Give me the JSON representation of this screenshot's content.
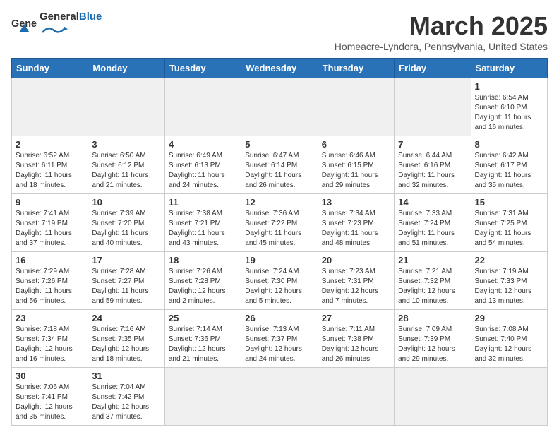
{
  "logo": {
    "general": "General",
    "blue": "Blue"
  },
  "header": {
    "month": "March 2025",
    "location": "Homeacre-Lyndora, Pennsylvania, United States"
  },
  "weekdays": [
    "Sunday",
    "Monday",
    "Tuesday",
    "Wednesday",
    "Thursday",
    "Friday",
    "Saturday"
  ],
  "weeks": [
    [
      {
        "day": "",
        "empty": true
      },
      {
        "day": "",
        "empty": true
      },
      {
        "day": "",
        "empty": true
      },
      {
        "day": "",
        "empty": true
      },
      {
        "day": "",
        "empty": true
      },
      {
        "day": "",
        "empty": true
      },
      {
        "day": "1",
        "info": "Sunrise: 6:54 AM\nSunset: 6:10 PM\nDaylight: 11 hours and 16 minutes."
      }
    ],
    [
      {
        "day": "2",
        "info": "Sunrise: 6:52 AM\nSunset: 6:11 PM\nDaylight: 11 hours and 18 minutes."
      },
      {
        "day": "3",
        "info": "Sunrise: 6:50 AM\nSunset: 6:12 PM\nDaylight: 11 hours and 21 minutes."
      },
      {
        "day": "4",
        "info": "Sunrise: 6:49 AM\nSunset: 6:13 PM\nDaylight: 11 hours and 24 minutes."
      },
      {
        "day": "5",
        "info": "Sunrise: 6:47 AM\nSunset: 6:14 PM\nDaylight: 11 hours and 26 minutes."
      },
      {
        "day": "6",
        "info": "Sunrise: 6:46 AM\nSunset: 6:15 PM\nDaylight: 11 hours and 29 minutes."
      },
      {
        "day": "7",
        "info": "Sunrise: 6:44 AM\nSunset: 6:16 PM\nDaylight: 11 hours and 32 minutes."
      },
      {
        "day": "8",
        "info": "Sunrise: 6:42 AM\nSunset: 6:17 PM\nDaylight: 11 hours and 35 minutes."
      }
    ],
    [
      {
        "day": "9",
        "info": "Sunrise: 7:41 AM\nSunset: 7:19 PM\nDaylight: 11 hours and 37 minutes."
      },
      {
        "day": "10",
        "info": "Sunrise: 7:39 AM\nSunset: 7:20 PM\nDaylight: 11 hours and 40 minutes."
      },
      {
        "day": "11",
        "info": "Sunrise: 7:38 AM\nSunset: 7:21 PM\nDaylight: 11 hours and 43 minutes."
      },
      {
        "day": "12",
        "info": "Sunrise: 7:36 AM\nSunset: 7:22 PM\nDaylight: 11 hours and 45 minutes."
      },
      {
        "day": "13",
        "info": "Sunrise: 7:34 AM\nSunset: 7:23 PM\nDaylight: 11 hours and 48 minutes."
      },
      {
        "day": "14",
        "info": "Sunrise: 7:33 AM\nSunset: 7:24 PM\nDaylight: 11 hours and 51 minutes."
      },
      {
        "day": "15",
        "info": "Sunrise: 7:31 AM\nSunset: 7:25 PM\nDaylight: 11 hours and 54 minutes."
      }
    ],
    [
      {
        "day": "16",
        "info": "Sunrise: 7:29 AM\nSunset: 7:26 PM\nDaylight: 11 hours and 56 minutes."
      },
      {
        "day": "17",
        "info": "Sunrise: 7:28 AM\nSunset: 7:27 PM\nDaylight: 11 hours and 59 minutes."
      },
      {
        "day": "18",
        "info": "Sunrise: 7:26 AM\nSunset: 7:28 PM\nDaylight: 12 hours and 2 minutes."
      },
      {
        "day": "19",
        "info": "Sunrise: 7:24 AM\nSunset: 7:30 PM\nDaylight: 12 hours and 5 minutes."
      },
      {
        "day": "20",
        "info": "Sunrise: 7:23 AM\nSunset: 7:31 PM\nDaylight: 12 hours and 7 minutes."
      },
      {
        "day": "21",
        "info": "Sunrise: 7:21 AM\nSunset: 7:32 PM\nDaylight: 12 hours and 10 minutes."
      },
      {
        "day": "22",
        "info": "Sunrise: 7:19 AM\nSunset: 7:33 PM\nDaylight: 12 hours and 13 minutes."
      }
    ],
    [
      {
        "day": "23",
        "info": "Sunrise: 7:18 AM\nSunset: 7:34 PM\nDaylight: 12 hours and 16 minutes."
      },
      {
        "day": "24",
        "info": "Sunrise: 7:16 AM\nSunset: 7:35 PM\nDaylight: 12 hours and 18 minutes."
      },
      {
        "day": "25",
        "info": "Sunrise: 7:14 AM\nSunset: 7:36 PM\nDaylight: 12 hours and 21 minutes."
      },
      {
        "day": "26",
        "info": "Sunrise: 7:13 AM\nSunset: 7:37 PM\nDaylight: 12 hours and 24 minutes."
      },
      {
        "day": "27",
        "info": "Sunrise: 7:11 AM\nSunset: 7:38 PM\nDaylight: 12 hours and 26 minutes."
      },
      {
        "day": "28",
        "info": "Sunrise: 7:09 AM\nSunset: 7:39 PM\nDaylight: 12 hours and 29 minutes."
      },
      {
        "day": "29",
        "info": "Sunrise: 7:08 AM\nSunset: 7:40 PM\nDaylight: 12 hours and 32 minutes."
      }
    ],
    [
      {
        "day": "30",
        "info": "Sunrise: 7:06 AM\nSunset: 7:41 PM\nDaylight: 12 hours and 35 minutes."
      },
      {
        "day": "31",
        "info": "Sunrise: 7:04 AM\nSunset: 7:42 PM\nDaylight: 12 hours and 37 minutes."
      },
      {
        "day": "",
        "empty": true
      },
      {
        "day": "",
        "empty": true
      },
      {
        "day": "",
        "empty": true
      },
      {
        "day": "",
        "empty": true
      },
      {
        "day": "",
        "empty": true
      }
    ]
  ]
}
